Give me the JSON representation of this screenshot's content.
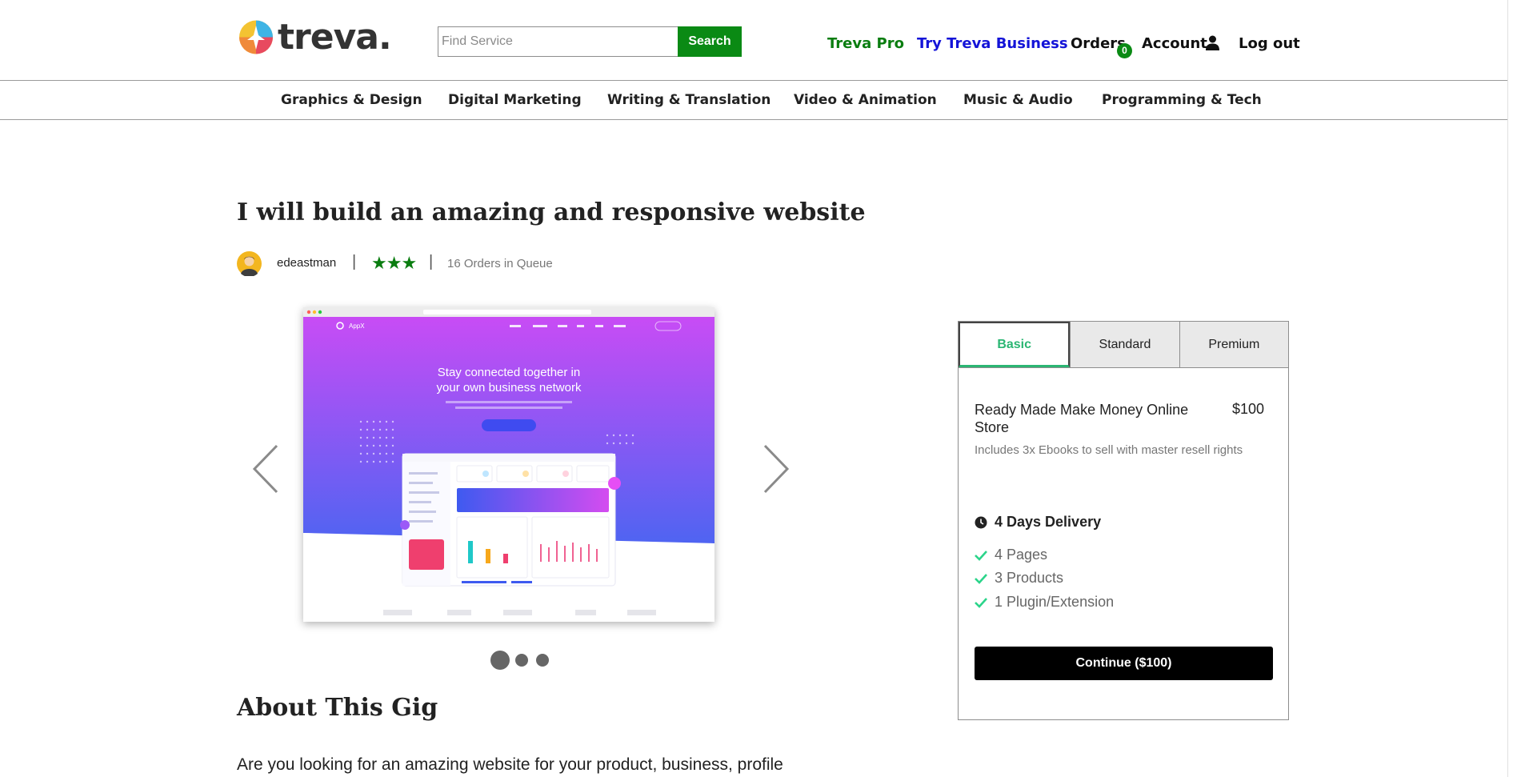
{
  "brand": {
    "name": "treva."
  },
  "search": {
    "placeholder": "Find Service",
    "button_label": "Search"
  },
  "nav": {
    "pro": "Treva Pro",
    "business": "Try Treva Business",
    "orders": "Orders",
    "orders_count": "0",
    "account": "Account",
    "logout": "Log out"
  },
  "categories": [
    "Graphics & Design",
    "Digital Marketing",
    "Writing & Translation",
    "Video & Animation",
    "Music & Audio",
    "Programming & Tech"
  ],
  "gig": {
    "title": "I will build an amazing and responsive website",
    "seller": "edeastman",
    "rating_stars": 3,
    "stars_text": "★★★",
    "queue": "16 Orders in Queue",
    "preview": {
      "headline_1": "Stay connected together in",
      "headline_2": "your own business network",
      "brand": "AppX"
    },
    "slides": 3,
    "active_slide": 1
  },
  "about": {
    "heading": "About This Gig",
    "text": "Are you looking for an amazing website for your product, business, profile"
  },
  "package": {
    "tabs": [
      "Basic",
      "Standard",
      "Premium"
    ],
    "active_tab": "Basic",
    "name": "Ready Made Make Money Online Store",
    "price": "$100",
    "description": "Includes 3x Ebooks to sell with master resell rights",
    "delivery": "4 Days Delivery",
    "features": [
      "4 Pages",
      "3 Products",
      "1 Plugin/Extension"
    ],
    "continue_label": "Continue ($100)"
  },
  "colors": {
    "green": "#0a8a14",
    "blue": "#1414d8",
    "accent": "#2bb673",
    "hero_top": "#c84cf5",
    "hero_bottom": "#4f64f2"
  },
  "icons": [
    "user-icon",
    "clock-icon",
    "check-icon",
    "chevron-left-icon",
    "chevron-right-icon"
  ]
}
